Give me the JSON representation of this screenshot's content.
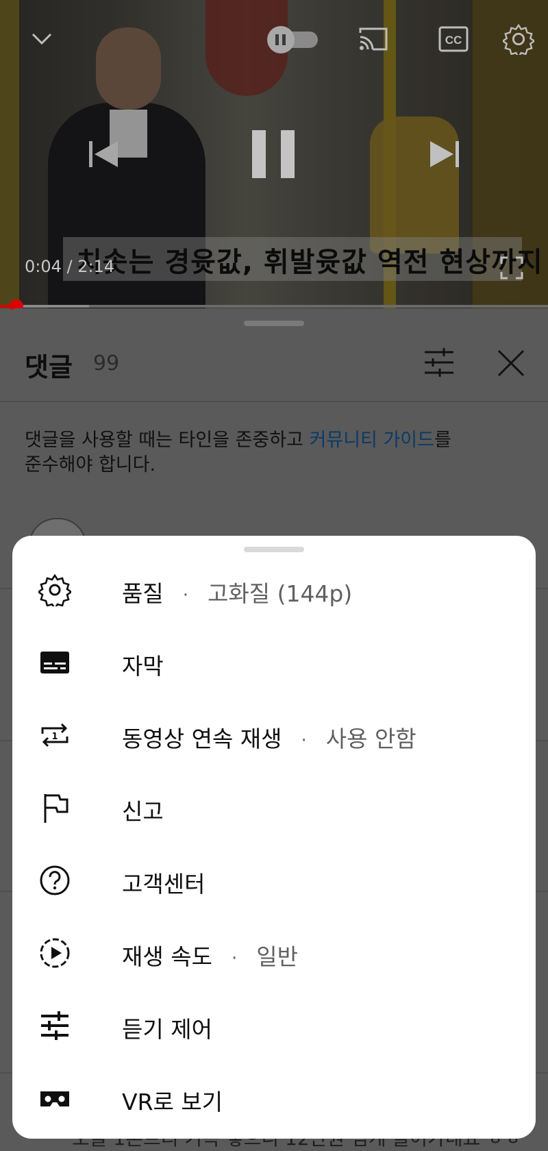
{
  "video": {
    "caption": "치솟는 경윳값, 휘발윳값 역전 현상까지",
    "time": "0:04 / 2:14",
    "progress_fraction": 0.03,
    "icons": [
      "chevron-down-icon",
      "autoplay-toggle-icon",
      "cast-icon",
      "closed-captions-icon",
      "settings-icon",
      "previous-icon",
      "pause-icon",
      "next-icon",
      "fullscreen-icon"
    ]
  },
  "comments": {
    "title": "댓글",
    "count": "99",
    "guide_text": "댓글을 사용할 때는 타인을 존중하고 ",
    "guide_link": "커뮤니티 가이드",
    "guide_suffix": "를",
    "guide_line2": "준수해야 합니다.",
    "peek_text": "오늘 1톤트리 기득 넣으니 12만원 넘게 들어가네요 ㅎㅎ"
  },
  "menu": {
    "items": [
      {
        "icon": "gear-icon",
        "label": "품질",
        "value": "고화질 (144p)"
      },
      {
        "icon": "subtitles-icon",
        "label": "자막",
        "value": ""
      },
      {
        "icon": "repeat-one-icon",
        "label": "동영상 연속 재생",
        "value": "사용 안함"
      },
      {
        "icon": "flag-icon",
        "label": "신고",
        "value": ""
      },
      {
        "icon": "help-icon",
        "label": "고객센터",
        "value": ""
      },
      {
        "icon": "playback-speed-icon",
        "label": "재생 속도",
        "value": "일반"
      },
      {
        "icon": "sliders-icon",
        "label": "듣기 제어",
        "value": ""
      },
      {
        "icon": "vr-headset-icon",
        "label": "VR로 보기",
        "value": ""
      }
    ]
  }
}
